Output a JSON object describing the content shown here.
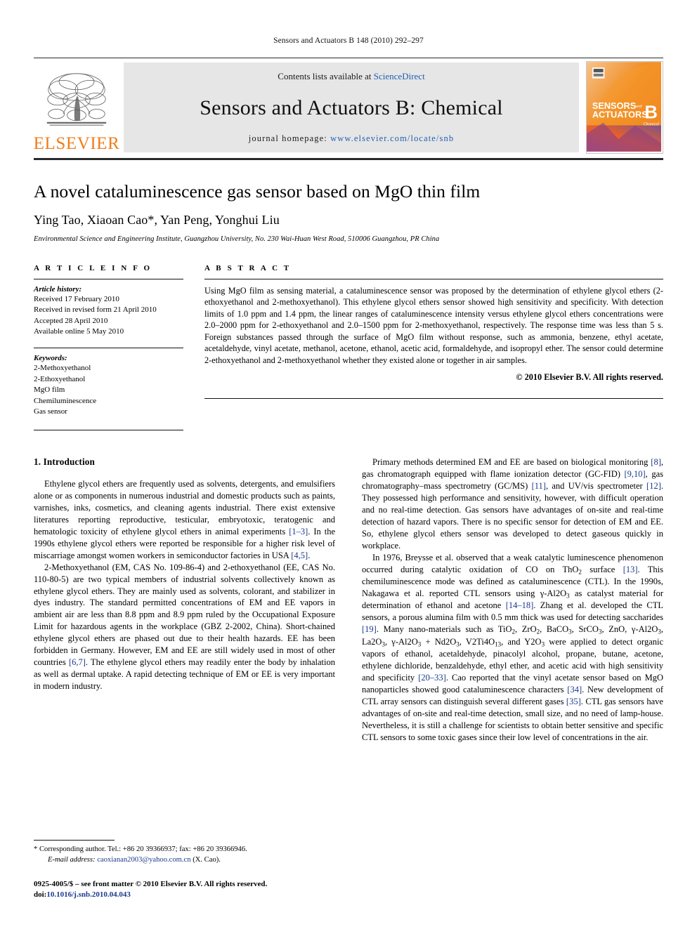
{
  "running_head": "Sensors and Actuators B 148 (2010) 292–297",
  "masthead": {
    "publisher_name": "ELSEVIER",
    "contents_prefix": "Contents lists available at ",
    "contents_link": "ScienceDirect",
    "journal_title": "Sensors and Actuators B: Chemical",
    "homepage_label": "journal homepage:",
    "homepage_url": "www.elsevier.com/locate/snb",
    "cover": {
      "line1": "SENSORS",
      "line2": "ACTUATORS",
      "and": "and",
      "letter": "B",
      "subtitle": "Chemical"
    }
  },
  "article": {
    "title": "A novel cataluminescence gas sensor based on MgO thin film",
    "authors": "Ying Tao, Xiaoan Cao*, Yan Peng, Yonghui Liu",
    "affiliation": "Environmental Science and Engineering Institute, Guangzhou University, No. 230 Wai-Huan West Road, 510006 Guangzhou, PR China"
  },
  "article_info": {
    "heading": "A R T I C L E    I N F O",
    "history_label": "Article history:",
    "history": [
      "Received 17 February 2010",
      "Received in revised form 21 April 2010",
      "Accepted 28 April 2010",
      "Available online 5 May 2010"
    ],
    "keywords_label": "Keywords:",
    "keywords": [
      "2-Methoxyethanol",
      "2-Ethoxyethanol",
      "MgO film",
      "Chemiluminescence",
      "Gas sensor"
    ]
  },
  "abstract": {
    "heading": "A B S T R A C T",
    "text": "Using MgO film as sensing material, a cataluminescence sensor was proposed by the determination of ethylene glycol ethers (2-ethoxyethanol and 2-methoxyethanol). This ethylene glycol ethers sensor showed high sensitivity and specificity. With detection limits of 1.0 ppm and 1.4 ppm, the linear ranges of cataluminescence intensity versus ethylene glycol ethers concentrations were 2.0–2000 ppm for 2-ethoxyethanol and 2.0–1500 ppm for 2-methoxyethanol, respectively. The response time was less than 5 s. Foreign substances passed through the surface of MgO film without response, such as ammonia, benzene, ethyl acetate, acetaldehyde, vinyl acetate, methanol, acetone, ethanol, acetic acid, formaldehyde, and isopropyl ether. The sensor could determine 2-ethoxyethanol and 2-methoxyethanol whether they existed alone or together in air samples.",
    "copyright": "© 2010 Elsevier B.V. All rights reserved."
  },
  "body": {
    "section1_heading": "1. Introduction",
    "left_paragraphs": [
      "Ethylene glycol ethers are frequently used as solvents, detergents, and emulsifiers alone or as components in numerous industrial and domestic products such as paints, varnishes, inks, cosmetics, and cleaning agents industrial. There exist extensive literatures reporting reproductive, testicular, embryotoxic, teratogenic and hematologic toxicity of ethylene glycol ethers in animal experiments [1–3]. In the 1990s ethylene glycol ethers were reported be responsible for a higher risk level of miscarriage amongst women workers in semiconductor factories in USA [4,5].",
      "2-Methoxyethanol (EM, CAS No. 109-86-4) and 2-ethoxyethanol (EE, CAS No. 110-80-5) are two typical members of industrial solvents collectively known as ethylene glycol ethers. They are mainly used as solvents, colorant, and stabilizer in dyes industry. The standard permitted concentrations of EM and EE vapors in ambient air are less than 8.8 ppm and 8.9 ppm ruled by the Occupational Exposure Limit for hazardous agents in the workplace (GBZ 2-2002, China). Short-chained ethylene glycol ethers are phased out due to their health hazards. EE has been forbidden in Germany. However, EM and EE are still widely used in most of other countries [6,7]. The ethylene glycol ethers may readily enter the body by inhalation as well as dermal uptake. A rapid detecting technique of EM or EE is very important in modern industry."
    ],
    "right_paragraphs": [
      "Primary methods determined EM and EE are based on biological monitoring [8], gas chromatograph equipped with flame ionization detector (GC-FID) [9,10], gas chromatography–mass spectrometry (GC/MS) [11], and UV/vis spectrometer [12]. They possessed high performance and sensitivity, however, with difficult operation and no real-time detection. Gas sensors have advantages of on-site and real-time detection of hazard vapors. There is no specific sensor for detection of EM and EE. So, ethylene glycol ethers sensor was developed to detect gaseous quickly in workplace.",
      "In 1976, Breysse et al. observed that a weak catalytic luminescence phenomenon occurred during catalytic oxidation of CO on ThO2 surface [13]. This chemiluminescence mode was defined as cataluminescence (CTL). In the 1990s, Nakagawa et al. reported CTL sensors using γ-Al2O3 as catalyst material for determination of ethanol and acetone [14–18]. Zhang et al. developed the CTL sensors, a porous alumina film with 0.5 mm thick was used for detecting saccharides [19]. Many nano-materials such as TiO2, ZrO2, BaCO3, SrCO3, ZnO, γ-Al2O3, La2O3, γ-Al2O3 + Nd2O3, V2Ti4O13, and Y2O3 were applied to detect organic vapors of ethanol, acetaldehyde, pinacolyl alcohol, propane, butane, acetone, ethylene dichloride, benzaldehyde, ethyl ether, and acetic acid with high sensitivity and specificity [20–33]. Cao reported that the vinyl acetate sensor based on MgO nanoparticles showed good cataluminescence characters [34]. New development of CTL array sensors can distinguish several different gases [35]. CTL gas sensors have advantages of on-site and real-time detection, small size, and no need of lamp-house. Nevertheless, it is still a challenge for scientists to obtain better sensitive and specific CTL sensors to some toxic gases since their low level of concentrations in the air."
    ]
  },
  "footer": {
    "corresponding_marker": "*",
    "corresponding_text": "Corresponding author. Tel.: +86 20 39366937; fax: +86 20 39366946.",
    "email_label": "E-mail address:",
    "email": "caoxianan2003@yahoo.com.cn",
    "email_owner": "(X. Cao).",
    "issn_line": "0925-4005/$ – see front matter © 2010 Elsevier B.V. All rights reserved.",
    "doi_label": "doi:",
    "doi_value": "10.1016/j.snb.2010.04.043"
  },
  "colors": {
    "elsevier_orange": "#ef7d1a",
    "link_blue": "#2060b0",
    "reference_blue": "#1b3a8c",
    "band_gray": "#e6e6e6"
  }
}
